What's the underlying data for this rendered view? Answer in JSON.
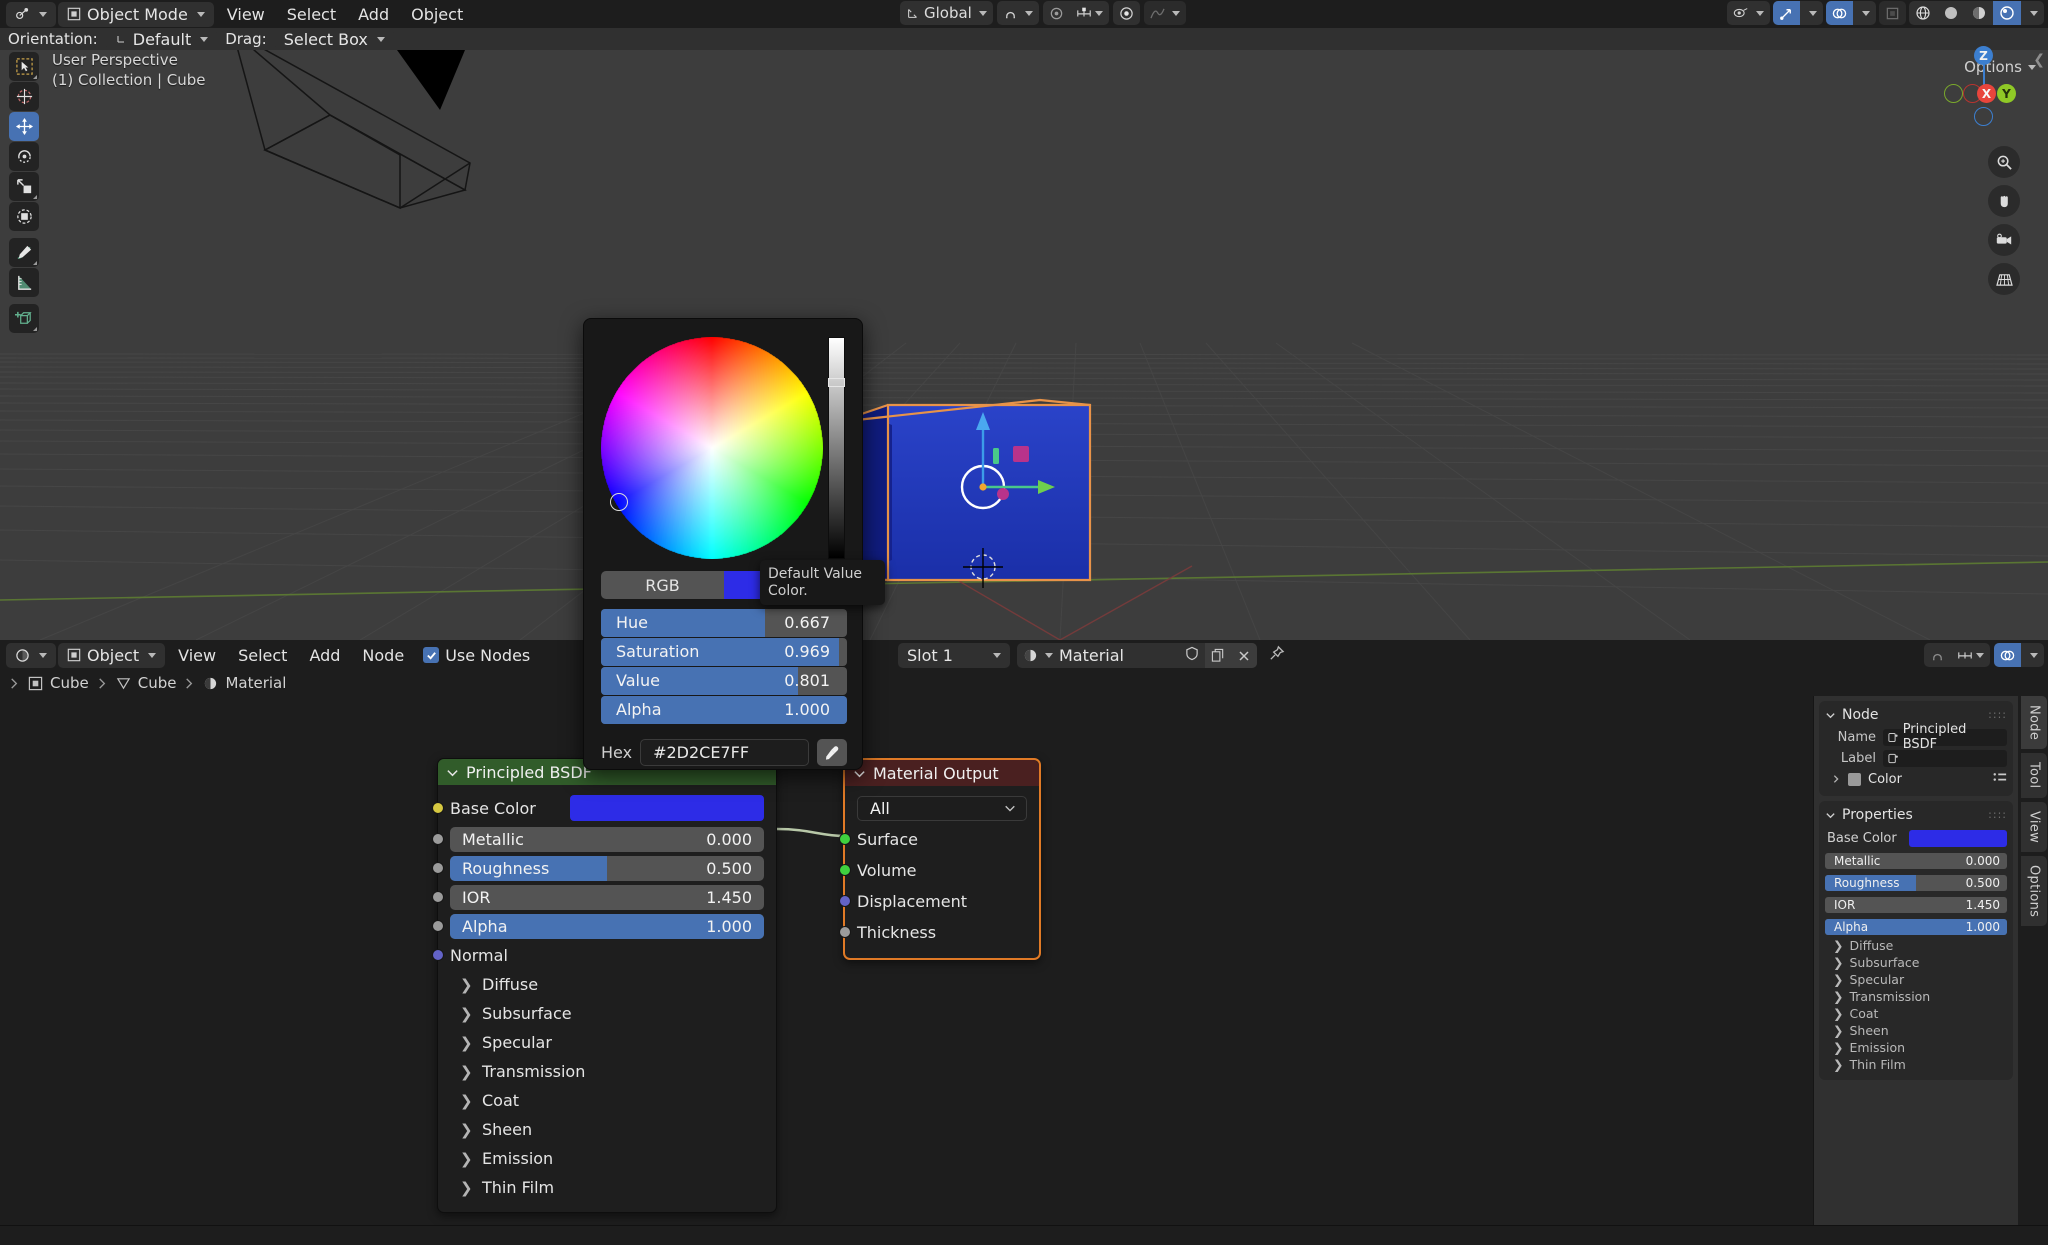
{
  "viewport": {
    "mode_label": "Object Mode",
    "menus": [
      "View",
      "Select",
      "Add",
      "Object"
    ],
    "orientation_label": "Orientation:",
    "orientation_value": "Default",
    "drag_label": "Drag:",
    "drag_value": "Select Box",
    "transform_orientation": "Global",
    "overlay_line1": "User Perspective",
    "overlay_line2": "(1) Collection | Cube",
    "options_label": "Options",
    "gizmo_axes": [
      "Z",
      "X",
      "Y"
    ],
    "tools": [
      {
        "name": "tweak-tool",
        "active": false
      },
      {
        "name": "cursor-tool",
        "active": false
      },
      {
        "name": "move-tool",
        "active": true
      },
      {
        "name": "rotate-tool",
        "active": false
      },
      {
        "name": "scale-tool",
        "active": false
      },
      {
        "name": "transform-tool",
        "active": false
      },
      {
        "name": "annotate-tool",
        "active": false
      },
      {
        "name": "measure-tool",
        "active": false
      },
      {
        "name": "add-cube-tool",
        "active": false
      }
    ],
    "nav_tools": [
      "zoom-icon",
      "hand-icon",
      "camera-icon",
      "grid-icon"
    ]
  },
  "shader_editor": {
    "editor_type": "Object",
    "menus": [
      "View",
      "Select",
      "Add",
      "Node"
    ],
    "use_nodes_label": "Use Nodes",
    "use_nodes_checked": true,
    "breadcrumb": [
      "Cube",
      "Cube",
      "Material"
    ],
    "slot_label": "Slot 1",
    "material_name": "Material",
    "nodes": {
      "principled": {
        "title": "Principled BSDF",
        "header_color": "#315c2a",
        "base_color_label": "Base Color",
        "base_color_hex": "#2D2CE7",
        "sliders": [
          {
            "label": "Metallic",
            "value": "0.000",
            "fill": 0.0
          },
          {
            "label": "Roughness",
            "value": "0.500",
            "fill": 0.5
          },
          {
            "label": "IOR",
            "value": "1.450",
            "fill": 0.0
          },
          {
            "label": "Alpha",
            "value": "1.000",
            "fill": 1.0
          }
        ],
        "normal_label": "Normal",
        "sections": [
          "Diffuse",
          "Subsurface",
          "Specular",
          "Transmission",
          "Coat",
          "Sheen",
          "Emission",
          "Thin Film"
        ]
      },
      "output": {
        "title": "Material Output",
        "header_color": "#4a2020",
        "target": "All",
        "inputs": [
          {
            "label": "Surface",
            "socket_color": "#3fd13f"
          },
          {
            "label": "Volume",
            "socket_color": "#3fd13f"
          },
          {
            "label": "Displacement",
            "socket_color": "#6363c7"
          },
          {
            "label": "Thickness",
            "socket_color": "#9b9b9b"
          }
        ]
      }
    },
    "npanel": {
      "tabs": [
        "Node",
        "Tool",
        "View",
        "Options"
      ],
      "active_tab": "Node",
      "node_panel_title": "Node",
      "name_label": "Name",
      "name_value": "Principled BSDF",
      "label_label": "Label",
      "label_value": "",
      "color_label": "Color",
      "properties_title": "Properties",
      "base_color_label": "Base Color",
      "base_color_hex": "#2D2CE7",
      "sliders": [
        {
          "label": "Metallic",
          "value": "0.000",
          "fill": 0.0
        },
        {
          "label": "Roughness",
          "value": "0.500",
          "fill": 0.5
        },
        {
          "label": "IOR",
          "value": "1.450",
          "fill": 0.0
        },
        {
          "label": "Alpha",
          "value": "1.000",
          "fill": 1.0
        }
      ],
      "sections": [
        "Diffuse",
        "Subsurface",
        "Specular",
        "Transmission",
        "Coat",
        "Sheen",
        "Emission",
        "Thin Film"
      ]
    }
  },
  "color_picker": {
    "mode_tab": "RGB",
    "sliders": [
      {
        "label": "Hue",
        "value": "0.667",
        "fill": 0.667
      },
      {
        "label": "Saturation",
        "value": "0.969",
        "fill": 0.969
      },
      {
        "label": "Value",
        "value": "0.801",
        "fill": 0.801
      },
      {
        "label": "Alpha",
        "value": "1.000",
        "fill": 1.0
      }
    ],
    "hex_label": "Hex",
    "hex_value": "#2D2CE7FF",
    "eyedropper_icon": "eyedropper-icon",
    "current_color": "#2D2CE7"
  },
  "tooltip": {
    "line1": "Default Value",
    "line2": "Color."
  }
}
